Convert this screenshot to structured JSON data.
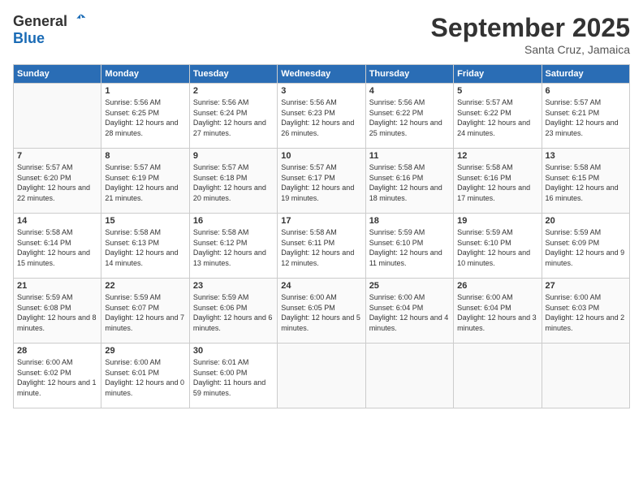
{
  "logo": {
    "line1": "General",
    "line2": "Blue"
  },
  "title": "September 2025",
  "subtitle": "Santa Cruz, Jamaica",
  "days_header": [
    "Sunday",
    "Monday",
    "Tuesday",
    "Wednesday",
    "Thursday",
    "Friday",
    "Saturday"
  ],
  "weeks": [
    [
      {
        "day": "",
        "empty": true
      },
      {
        "day": "1",
        "sunrise": "5:56 AM",
        "sunset": "6:25 PM",
        "daylight": "12 hours and 28 minutes."
      },
      {
        "day": "2",
        "sunrise": "5:56 AM",
        "sunset": "6:24 PM",
        "daylight": "12 hours and 27 minutes."
      },
      {
        "day": "3",
        "sunrise": "5:56 AM",
        "sunset": "6:23 PM",
        "daylight": "12 hours and 26 minutes."
      },
      {
        "day": "4",
        "sunrise": "5:56 AM",
        "sunset": "6:22 PM",
        "daylight": "12 hours and 25 minutes."
      },
      {
        "day": "5",
        "sunrise": "5:57 AM",
        "sunset": "6:22 PM",
        "daylight": "12 hours and 24 minutes."
      },
      {
        "day": "6",
        "sunrise": "5:57 AM",
        "sunset": "6:21 PM",
        "daylight": "12 hours and 23 minutes."
      }
    ],
    [
      {
        "day": "7",
        "sunrise": "5:57 AM",
        "sunset": "6:20 PM",
        "daylight": "12 hours and 22 minutes."
      },
      {
        "day": "8",
        "sunrise": "5:57 AM",
        "sunset": "6:19 PM",
        "daylight": "12 hours and 21 minutes."
      },
      {
        "day": "9",
        "sunrise": "5:57 AM",
        "sunset": "6:18 PM",
        "daylight": "12 hours and 20 minutes."
      },
      {
        "day": "10",
        "sunrise": "5:57 AM",
        "sunset": "6:17 PM",
        "daylight": "12 hours and 19 minutes."
      },
      {
        "day": "11",
        "sunrise": "5:58 AM",
        "sunset": "6:16 PM",
        "daylight": "12 hours and 18 minutes."
      },
      {
        "day": "12",
        "sunrise": "5:58 AM",
        "sunset": "6:16 PM",
        "daylight": "12 hours and 17 minutes."
      },
      {
        "day": "13",
        "sunrise": "5:58 AM",
        "sunset": "6:15 PM",
        "daylight": "12 hours and 16 minutes."
      }
    ],
    [
      {
        "day": "14",
        "sunrise": "5:58 AM",
        "sunset": "6:14 PM",
        "daylight": "12 hours and 15 minutes."
      },
      {
        "day": "15",
        "sunrise": "5:58 AM",
        "sunset": "6:13 PM",
        "daylight": "12 hours and 14 minutes."
      },
      {
        "day": "16",
        "sunrise": "5:58 AM",
        "sunset": "6:12 PM",
        "daylight": "12 hours and 13 minutes."
      },
      {
        "day": "17",
        "sunrise": "5:58 AM",
        "sunset": "6:11 PM",
        "daylight": "12 hours and 12 minutes."
      },
      {
        "day": "18",
        "sunrise": "5:59 AM",
        "sunset": "6:10 PM",
        "daylight": "12 hours and 11 minutes."
      },
      {
        "day": "19",
        "sunrise": "5:59 AM",
        "sunset": "6:10 PM",
        "daylight": "12 hours and 10 minutes."
      },
      {
        "day": "20",
        "sunrise": "5:59 AM",
        "sunset": "6:09 PM",
        "daylight": "12 hours and 9 minutes."
      }
    ],
    [
      {
        "day": "21",
        "sunrise": "5:59 AM",
        "sunset": "6:08 PM",
        "daylight": "12 hours and 8 minutes."
      },
      {
        "day": "22",
        "sunrise": "5:59 AM",
        "sunset": "6:07 PM",
        "daylight": "12 hours and 7 minutes."
      },
      {
        "day": "23",
        "sunrise": "5:59 AM",
        "sunset": "6:06 PM",
        "daylight": "12 hours and 6 minutes."
      },
      {
        "day": "24",
        "sunrise": "6:00 AM",
        "sunset": "6:05 PM",
        "daylight": "12 hours and 5 minutes."
      },
      {
        "day": "25",
        "sunrise": "6:00 AM",
        "sunset": "6:04 PM",
        "daylight": "12 hours and 4 minutes."
      },
      {
        "day": "26",
        "sunrise": "6:00 AM",
        "sunset": "6:04 PM",
        "daylight": "12 hours and 3 minutes."
      },
      {
        "day": "27",
        "sunrise": "6:00 AM",
        "sunset": "6:03 PM",
        "daylight": "12 hours and 2 minutes."
      }
    ],
    [
      {
        "day": "28",
        "sunrise": "6:00 AM",
        "sunset": "6:02 PM",
        "daylight": "12 hours and 1 minute."
      },
      {
        "day": "29",
        "sunrise": "6:00 AM",
        "sunset": "6:01 PM",
        "daylight": "12 hours and 0 minutes."
      },
      {
        "day": "30",
        "sunrise": "6:01 AM",
        "sunset": "6:00 PM",
        "daylight": "11 hours and 59 minutes."
      },
      {
        "day": "",
        "empty": true
      },
      {
        "day": "",
        "empty": true
      },
      {
        "day": "",
        "empty": true
      },
      {
        "day": "",
        "empty": true
      }
    ]
  ]
}
